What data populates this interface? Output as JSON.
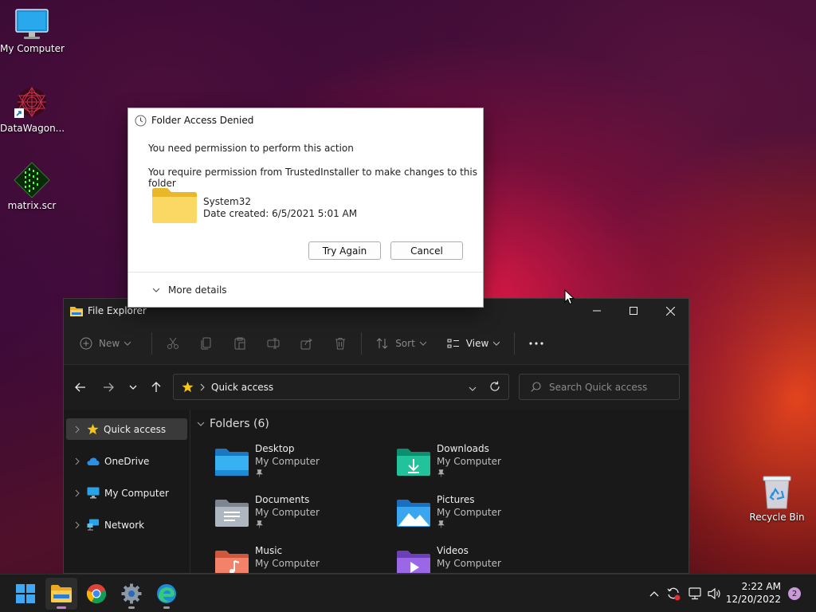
{
  "desktop": {
    "icons": [
      {
        "label": "My Computer",
        "icon": "monitor-icon"
      },
      {
        "label": "DataWagon...",
        "icon": "datawagon-shortcut-icon"
      },
      {
        "label": "matrix.scr",
        "icon": "matrix-screensaver-icon"
      },
      {
        "label": "Recycle Bin",
        "icon": "recycle-bin-icon"
      }
    ]
  },
  "dialog": {
    "title": "Folder Access Denied",
    "message1": "You need permission to perform this action",
    "message2": "You require permission from TrustedInstaller to make changes to this folder",
    "folder_name": "System32",
    "date_created": "Date created: 6/5/2021 5:01 AM",
    "try_again_label": "Try Again",
    "cancel_label": "Cancel",
    "more_details_label": "More details"
  },
  "explorer": {
    "title": "File Explorer",
    "toolbar": {
      "new_label": "New",
      "sort_label": "Sort",
      "view_label": "View"
    },
    "address": {
      "location": "Quick access"
    },
    "search": {
      "placeholder": "Search Quick access"
    },
    "sidebar": {
      "items": [
        {
          "label": "Quick access",
          "icon": "star-icon",
          "selected": true
        },
        {
          "label": "OneDrive",
          "icon": "cloud-icon"
        },
        {
          "label": "My Computer",
          "icon": "monitor-icon"
        },
        {
          "label": "Network",
          "icon": "network-icon"
        }
      ]
    },
    "group_header": "Folders (6)",
    "folders": [
      {
        "name": "Desktop",
        "location": "My Computer",
        "pinned": true
      },
      {
        "name": "Downloads",
        "location": "My Computer",
        "pinned": true
      },
      {
        "name": "Documents",
        "location": "My Computer",
        "pinned": true
      },
      {
        "name": "Pictures",
        "location": "My Computer",
        "pinned": true
      },
      {
        "name": "Music",
        "location": "My Computer",
        "pinned": false
      },
      {
        "name": "Videos",
        "location": "My Computer",
        "pinned": false
      }
    ]
  },
  "taskbar": {
    "apps": [
      "start",
      "file-explorer",
      "chrome",
      "settings",
      "edge"
    ],
    "clock": {
      "time": "2:22 AM",
      "date": "12/20/2022"
    },
    "notification_count": "2"
  },
  "colors": {
    "accent": "#0067c0",
    "folder_yellow": "#f5c518",
    "explorer_bg": "#191919",
    "taskbar_bg": "#1c1c1c"
  }
}
